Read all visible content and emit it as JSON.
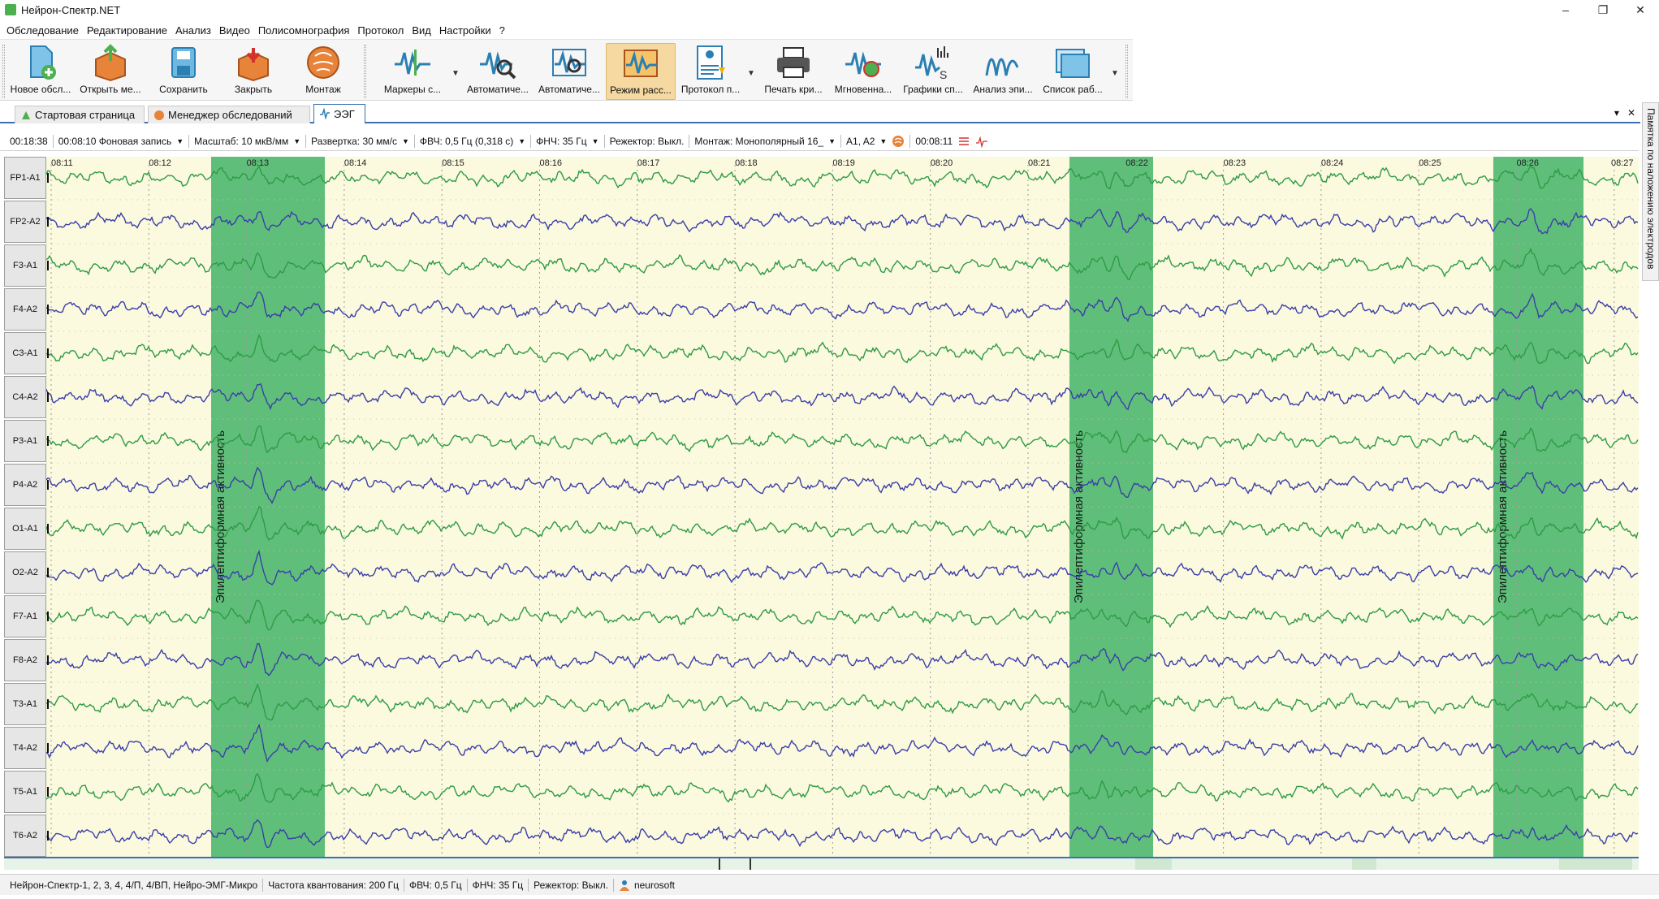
{
  "window": {
    "title": "Нейрон-Спектр.NET",
    "controls": [
      "–",
      "❐",
      "✕"
    ]
  },
  "menu": [
    "Обследование",
    "Редактирование",
    "Анализ",
    "Видео",
    "Полисомнография",
    "Протокол",
    "Вид",
    "Настройки",
    "?"
  ],
  "toolbar": {
    "new_exam": "Новое обсл...",
    "open": "Открыть ме...",
    "save": "Сохранить",
    "close": "Закрыть",
    "montage": "Монтаж",
    "markers": "Маркеры с...",
    "auto1": "Автоматиче...",
    "auto2": "Автоматиче...",
    "mode": "Режим расс...",
    "protocol": "Протокол п...",
    "print": "Печать кри...",
    "instant": "Мгновенна...",
    "spectra": "Графики сп...",
    "epi": "Анализ эпи...",
    "worklist": "Список раб..."
  },
  "tabs": {
    "start": "Стартовая страница",
    "manager": "Менеджер обследований",
    "eeg": "ЭЭГ",
    "pin": "▾",
    "close": "✕"
  },
  "side_panel": "Памятка по наложению электродов",
  "params": {
    "total_time": "00:18:38",
    "segment": "00:08:10 Фоновая запись",
    "scale": "Масштаб:  10 мкВ/мм",
    "sweep": "Развертка:  30 мм/с",
    "hpf": "ФВЧ:  0,5 Гц (0,318 с)",
    "lpf": "ФНЧ:  35 Гц",
    "notch": "Режектор:  Выкл.",
    "montage": "Монтаж:  Монополярный 16_",
    "ref": "A1, A2",
    "cursor_time": "00:08:11"
  },
  "channels": [
    "FP1-A1",
    "FP2-A2",
    "F3-A1",
    "F4-A2",
    "C3-A1",
    "C4-A2",
    "P3-A1",
    "P4-A2",
    "O1-A1",
    "O2-A2",
    "F7-A1",
    "F8-A2",
    "T3-A1",
    "T4-A2",
    "T5-A1",
    "T6-A2"
  ],
  "time_ticks": [
    "08:11",
    "08:12",
    "08:13",
    "08:14",
    "08:15",
    "08:16",
    "08:17",
    "08:18",
    "08:19",
    "08:20",
    "08:21",
    "08:22",
    "08:23",
    "08:24",
    "08:25",
    "08:26",
    "08:27"
  ],
  "annotation_label": "Эпилептиформная активность",
  "colors": {
    "trace_green": "#2e9b45",
    "trace_blue": "#3a3fa8",
    "annotation": "#5fbf7a",
    "background": "#fbf9de"
  },
  "status": {
    "devices": "Нейрон-Спектр-1, 2, 3, 4, 4/П, 4/ВП, Нейро-ЭМГ-Микро",
    "sampling": "Частота квантования:  200 Гц",
    "hpf": "ФВЧ:  0,5 Гц",
    "lpf": "ФНЧ:  35 Гц",
    "notch": "Режектор:  Выкл.",
    "user": "neurosoft"
  }
}
